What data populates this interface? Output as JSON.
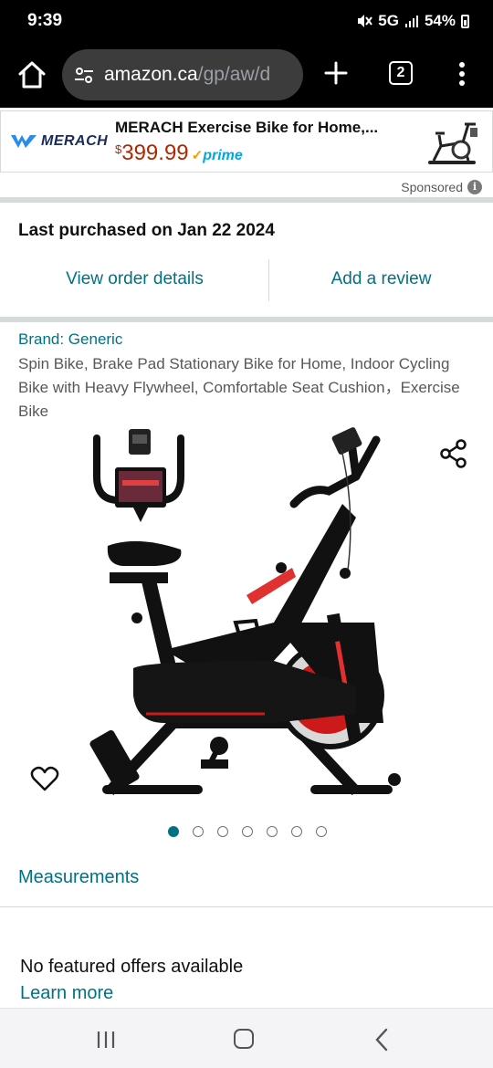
{
  "status_bar": {
    "time": "9:39",
    "network": "5G",
    "battery": "54%",
    "icons": [
      "mute-icon",
      "signal-icon",
      "battery-icon"
    ]
  },
  "browser": {
    "url_domain": "amazon.ca",
    "url_path": "/gp/aw/d",
    "tab_count": "2",
    "icons": [
      "home-icon",
      "site-settings-icon",
      "new-tab-icon",
      "tab-switcher-icon",
      "overflow-menu-icon"
    ]
  },
  "ad": {
    "brand": "MERACH",
    "title": "MERACH Exercise Bike for Home,...",
    "currency": "$",
    "price": "399.99",
    "prime_check": "✓",
    "prime_label": "prime",
    "sponsored": "Sponsored",
    "info": "i"
  },
  "purchase": {
    "last_purchased": "Last purchased on Jan 22 2024",
    "view_order": "View order details",
    "add_review": "Add a review"
  },
  "product": {
    "brand_link": "Brand: Generic",
    "title": "Spin Bike, Brake Pad Stationary Bike for Home, Indoor Cycling Bike with Heavy Flywheel, Comfortable Seat Cushion，Exercise Bike",
    "image_count": 7,
    "active_image": 0,
    "measurements": "Measurements"
  },
  "offers": {
    "no_offers": "No featured offers available",
    "learn_more": "Learn more"
  },
  "colors": {
    "link": "#007185",
    "price": "#b12704",
    "prime": "#00a8e1",
    "divider": "#d5dbdb"
  },
  "nav_bar": {
    "icons": [
      "recent-apps-icon",
      "home-icon",
      "back-icon"
    ]
  }
}
